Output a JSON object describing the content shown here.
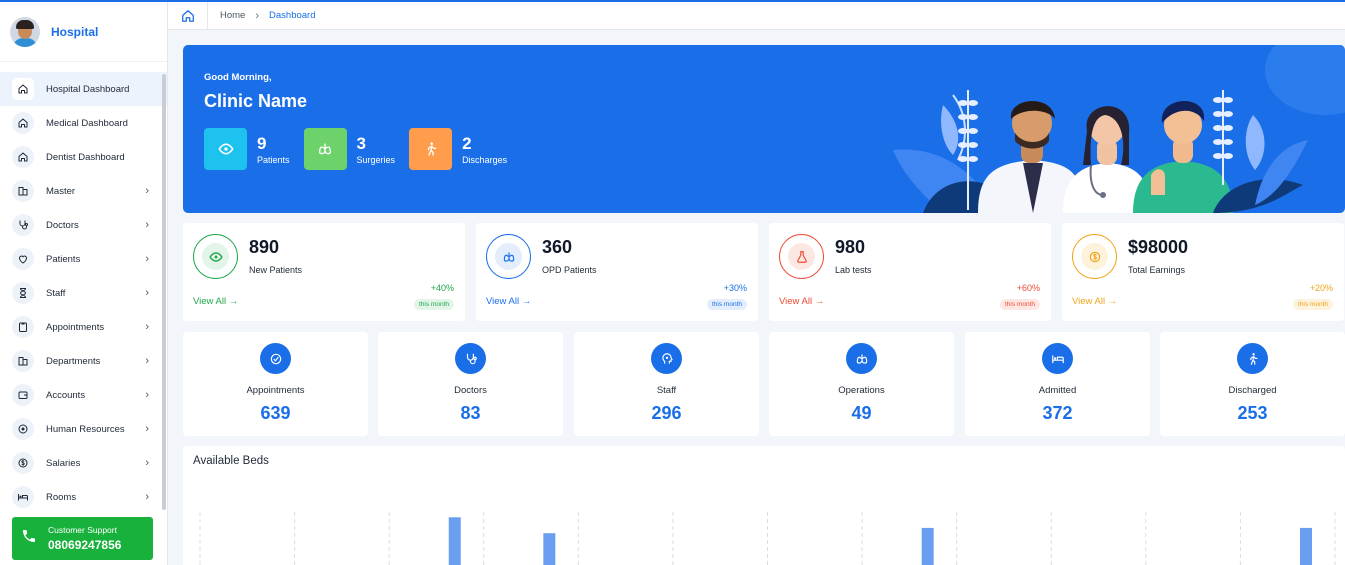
{
  "sidebar": {
    "brand": "Hospital",
    "items": [
      {
        "label": "Hospital Dashboard",
        "icon": "home-icon",
        "active": true,
        "chevron": false
      },
      {
        "label": "Medical Dashboard",
        "icon": "home-icon",
        "chevron": false
      },
      {
        "label": "Dentist Dashboard",
        "icon": "home-icon",
        "chevron": false
      },
      {
        "label": "Master",
        "icon": "building-icon",
        "chevron": true
      },
      {
        "label": "Doctors",
        "icon": "stethoscope-icon",
        "chevron": true
      },
      {
        "label": "Patients",
        "icon": "heart-icon",
        "chevron": true
      },
      {
        "label": "Staff",
        "icon": "hourglass-icon",
        "chevron": true
      },
      {
        "label": "Appointments",
        "icon": "clipboard-icon",
        "chevron": true
      },
      {
        "label": "Departments",
        "icon": "building-icon",
        "chevron": true
      },
      {
        "label": "Accounts",
        "icon": "wallet-icon",
        "chevron": true
      },
      {
        "label": "Human Resources",
        "icon": "gear-icon",
        "chevron": true
      },
      {
        "label": "Salaries",
        "icon": "dollar-icon",
        "chevron": true
      },
      {
        "label": "Rooms",
        "icon": "bed-icon",
        "chevron": true
      }
    ],
    "chevron": "›",
    "support": {
      "title": "Customer Support",
      "phone": "08069247856"
    }
  },
  "breadcrumb": {
    "home": "Home",
    "separator": "›",
    "current": "Dashboard"
  },
  "hero": {
    "greeting": "Good Morning,",
    "clinic": "Clinic Name",
    "stats": [
      {
        "value": "9",
        "label": "Patients",
        "color": "#1ec2ee",
        "icon": "eye-icon"
      },
      {
        "value": "3",
        "label": "Surgeries",
        "color": "#6ed26a",
        "icon": "lungs-icon"
      },
      {
        "value": "2",
        "label": "Discharges",
        "color": "#ff9d4d",
        "icon": "walk-icon"
      }
    ]
  },
  "cards": [
    {
      "value": "890",
      "label": "New Patients",
      "link": "View All",
      "change": "+40%",
      "period": "this month",
      "color": "#1fa84a",
      "tint": "#e3f5e8",
      "icon": "eye-icon"
    },
    {
      "value": "360",
      "label": "OPD Patients",
      "link": "View All",
      "change": "+30%",
      "period": "this month",
      "color": "#1a6fe8",
      "tint": "#e3edfb",
      "icon": "lungs-icon"
    },
    {
      "value": "980",
      "label": "Lab tests",
      "link": "View All",
      "change": "+60%",
      "period": "this month",
      "color": "#ef4b35",
      "tint": "#fde7e3",
      "icon": "flask-icon"
    },
    {
      "value": "$98000",
      "label": "Total Earnings",
      "link": "View All",
      "change": "+20%",
      "period": "this month",
      "color": "#f0a51a",
      "tint": "#fdf2dc",
      "icon": "dollar-icon"
    }
  ],
  "view_arrow": "→",
  "metrics": [
    {
      "label": "Appointments",
      "value": "639",
      "icon": "check-circle-icon"
    },
    {
      "label": "Doctors",
      "value": "83",
      "icon": "stethoscope-icon"
    },
    {
      "label": "Staff",
      "value": "296",
      "icon": "head-icon"
    },
    {
      "label": "Operations",
      "value": "49",
      "icon": "lungs-icon"
    },
    {
      "label": "Admitted",
      "value": "372",
      "icon": "bed-icon"
    },
    {
      "label": "Discharged",
      "value": "253",
      "icon": "walk-icon"
    }
  ],
  "beds": {
    "title": "Available Beds"
  },
  "chart_data": {
    "type": "bar",
    "title": "Available Beds",
    "grid": true,
    "note": "chart is cut off at the bottom of the screenshot; only bar tops are visible",
    "bar_color": "#6a9ef0",
    "bar_tops": [
      null,
      null,
      null,
      0.9,
      0.6,
      null,
      null,
      null,
      0.7,
      null,
      null,
      null,
      0.7
    ]
  }
}
